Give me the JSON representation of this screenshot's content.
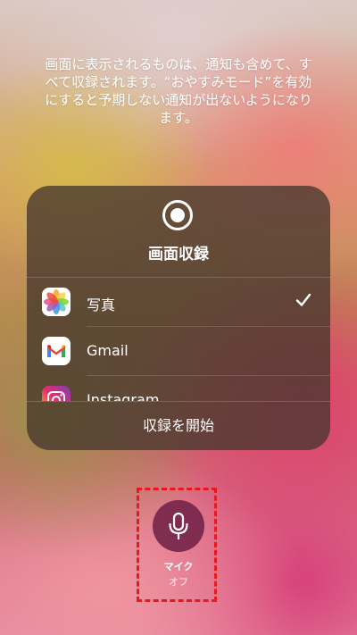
{
  "notice": {
    "lines": [
      "画面に表示されるものは、通知も含めて、す",
      "べて収録されます。“おやすみモード”を有効",
      "にすると予期しない通知が出ないようになり",
      "ます。"
    ]
  },
  "panel": {
    "title": "画面収録",
    "apps": [
      {
        "label": "写真",
        "icon": "photos-icon",
        "selected": true
      },
      {
        "label": "Gmail",
        "icon": "gmail-icon",
        "selected": false
      },
      {
        "label": "Instagram",
        "icon": "instagram-icon",
        "selected": false
      }
    ],
    "start_label": "収録を開始"
  },
  "mic": {
    "label": "マイク",
    "state": "オフ",
    "icon": "microphone-icon"
  },
  "colors": {
    "highlight": "#e8181e",
    "mic_background": "#6e1e46"
  }
}
